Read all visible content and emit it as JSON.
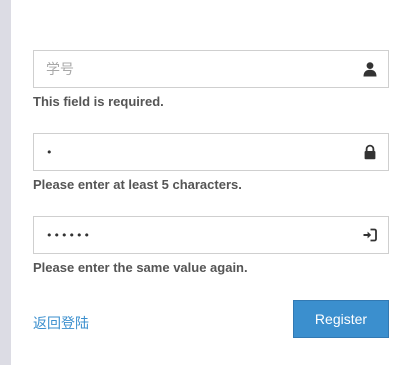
{
  "form": {
    "username": {
      "value": "",
      "placeholder": "学号",
      "icon": "user-icon",
      "error": "This field is required."
    },
    "password": {
      "value": "•",
      "placeholder": "",
      "icon": "lock-icon",
      "error": "Please enter at least 5 characters."
    },
    "confirm_password": {
      "value": "••••••",
      "placeholder": "",
      "icon": "sign-in-icon",
      "error": "Please enter the same value again."
    }
  },
  "actions": {
    "back_label": "返回登陆",
    "register_label": "Register",
    "accent_color": "#3b8fce"
  }
}
